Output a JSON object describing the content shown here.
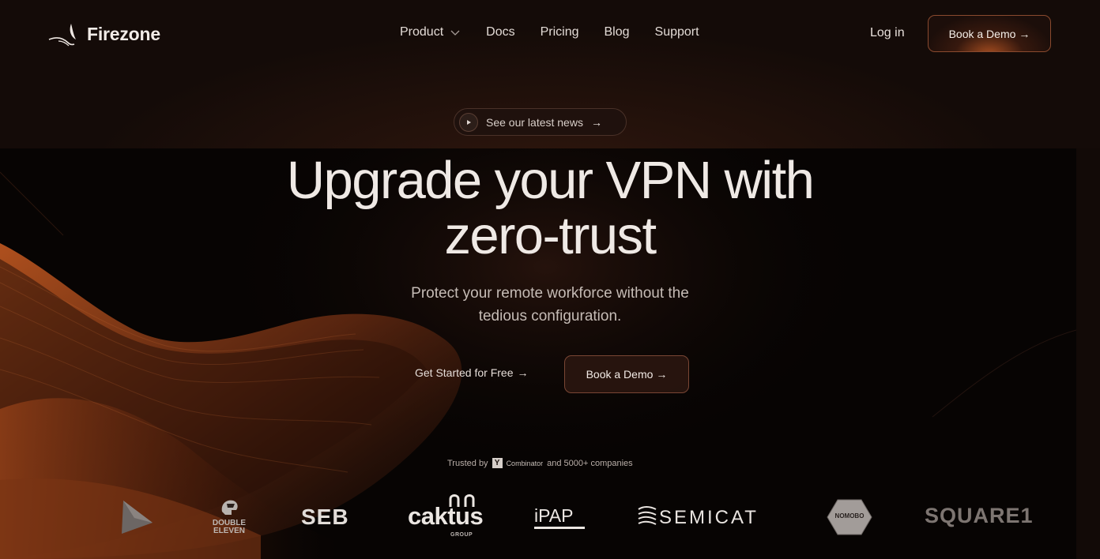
{
  "brand": {
    "name": "Firezone"
  },
  "nav": {
    "items": [
      {
        "label": "Product",
        "has_dropdown": true
      },
      {
        "label": "Docs"
      },
      {
        "label": "Pricing"
      },
      {
        "label": "Blog"
      },
      {
        "label": "Support"
      }
    ],
    "login_label": "Log in",
    "demo_label": "Book a Demo",
    "arrow": "→"
  },
  "news": {
    "label": "See our latest news",
    "arrow": "→"
  },
  "hero": {
    "title_line1": "Upgrade your VPN with",
    "title_line2": "zero-trust",
    "subtitle_line1": "Protect your remote workforce without the",
    "subtitle_line2": "tedious configuration.",
    "primary_cta": "Get Started for Free",
    "secondary_cta": "Book a Demo",
    "arrow": "→"
  },
  "trusted": {
    "prefix": "Trusted by",
    "yc_letter": "Y",
    "yc_name": "Combinator",
    "suffix": "and 5000+ companies"
  },
  "logos": {
    "double_eleven_line1": "DOUBLE",
    "double_eleven_line2": "ELEVEN",
    "seb": "SEB",
    "caktus": "caktus",
    "caktus_sub": "GROUP",
    "ipap": "iPAP",
    "semicat": "SEMICAT",
    "nomobo": "NOMOBO",
    "square1": "SQUARE1"
  },
  "colors": {
    "background": "#0c0706",
    "accent_orange": "#d9642a",
    "border_orange": "#8a4a2e",
    "text_primary": "#efe9e5"
  }
}
